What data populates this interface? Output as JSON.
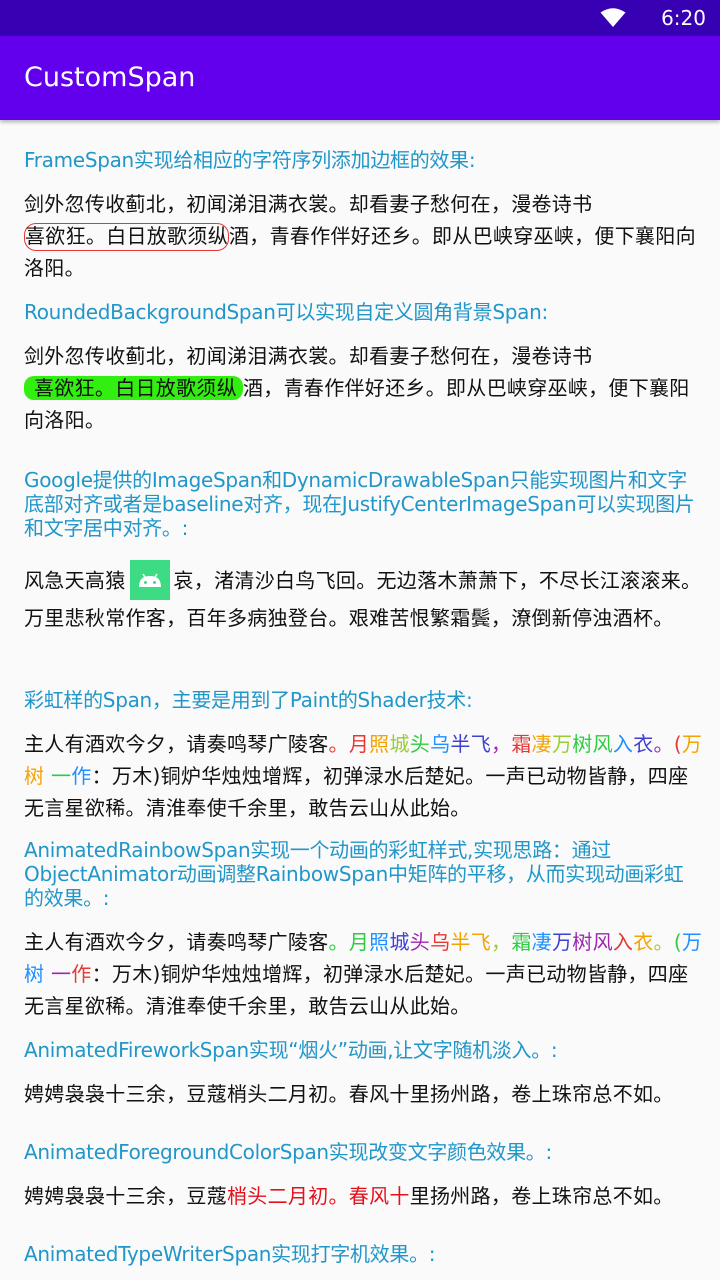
{
  "status_bar": {
    "time": "6:20",
    "wifi_icon": "wifi-icon"
  },
  "app_bar": {
    "title": "CustomSpan"
  },
  "colors": {
    "status_bar": "#3700b3",
    "app_bar": "#6200ee",
    "section_title": "#2196c9",
    "frame_border": "#e53935",
    "rounded_bg": "#33ee11",
    "fg_highlight": "#e5101a"
  },
  "sections": {
    "frame": {
      "title": "FrameSpan实现给相应的字符序列添加边框的效果:",
      "line1": "剑外忽传收蓟北，初闻涕泪满衣裳。却看妻子愁何在，漫卷诗书",
      "framed": "喜欲狂。白日放歌须纵",
      "rest": "酒，青春作伴好还乡。即从巴峡穿巫峡，便下襄阳向洛阳。"
    },
    "rounded": {
      "title": "RoundedBackgroundSpan可以实现自定义圆角背景Span:",
      "line1": "剑外忽传收蓟北，初闻涕泪满衣裳。却看妻子愁何在，漫卷诗书",
      "highlight": "喜欲狂。白日放歌须纵",
      "rest": "酒，青春作伴好还乡。即从巴峡穿巫峡，便下襄阳向洛阳。"
    },
    "image": {
      "title": "Google提供的ImageSpan和DynamicDrawableSpan只能实现图片和文字底部对齐或者是baseline对齐，现在JustifyCenterImageSpan可以实现图片和文字居中对齐。:",
      "before": "风急天高猿",
      "icon": "android-icon",
      "after": "哀，渚清沙白鸟飞回。无边落木萧萧下，不尽长江滚滚来。万里悲秋常作客，百年多病独登台。艰难苦恨繁霜鬓，潦倒新停浊酒杯。"
    },
    "rainbow": {
      "title": "彩虹样的Span，主要是用到了Paint的Shader技术:",
      "plain1": "主人有酒欢今夕，请奏鸣琴广陵客",
      "rainbow": "。月照城头乌半飞，霜凄万树风入衣。(万树 一作",
      "plain2": "：万木)铜炉华烛烛增辉，初弹渌水后楚妃。一声已动物皆静，四座无言星欲稀。清淮奉使千余里，敢告云山从此始。"
    },
    "animated_rainbow": {
      "title": "AnimatedRainbowSpan实现一个动画的彩虹样式,实现思路：通过ObjectAnimator动画调整RainbowSpan中矩阵的平移，从而实现动画彩虹的效果。:",
      "plain1": "主人有酒欢今夕，请奏鸣琴广陵客",
      "rainbow": "。月照城头乌半飞，霜凄万树风入衣。(万树 一作",
      "plain2": "：万木)铜炉华烛烛增辉，初弹渌水后楚妃。一声已动物皆静，四座无言星欲稀。清淮奉使千余里，敢告云山从此始。"
    },
    "firework": {
      "title": "AnimatedFireworkSpan实现“烟火”动画,让文字随机淡入。:",
      "text": "娉娉袅袅十三余，豆蔻梢头二月初。春风十里扬州路，卷上珠帘总不如。"
    },
    "fgcolor": {
      "title": "AnimatedForegroundColorSpan实现改变文字颜色效果。:",
      "before": "娉娉袅袅十三余，豆蔻",
      "colored": "梢头二月初。春风十",
      "after": "里扬州路，卷上珠帘总不如。"
    },
    "typewriter": {
      "title": "AnimatedTypeWriterSpan实现打字机效果。:"
    }
  },
  "rainbow_palette": [
    "#e53935",
    "#f4a300",
    "#9acd32",
    "#2ecc40",
    "#1e90ff",
    "#3f3fd0",
    "#9c27b0"
  ],
  "rainbow_palette_2": [
    "#2ecc40",
    "#1e90ff",
    "#3f3fd0",
    "#9c27b0",
    "#e53935",
    "#f4a300",
    "#9acd32"
  ]
}
